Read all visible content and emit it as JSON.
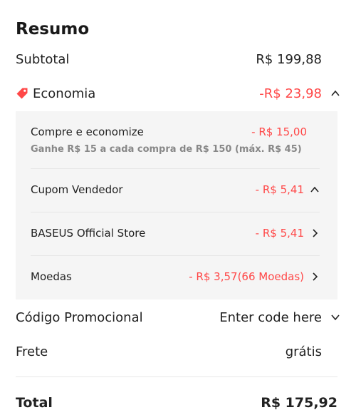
{
  "summary": {
    "title": "Resumo",
    "subtotal": {
      "label": "Subtotal",
      "value": "R$ 199,88"
    },
    "economia": {
      "label": "Economia",
      "value": "-R$ 23,98",
      "icon": "tag-icon",
      "accent": "#ff4747"
    },
    "details": {
      "compre": {
        "label": "Compre e economize",
        "value": "- R$ 15,00",
        "note": "Ganhe R$ 15 a cada compra de R$ 150 (máx. R$ 45)"
      },
      "cupom": {
        "label": "Cupom Vendedor",
        "value": "- R$ 5,41"
      },
      "store": {
        "label": "BASEUS Official Store",
        "value": "- R$ 5,41"
      },
      "moedas": {
        "label": "Moedas",
        "value": "- R$ 3,57(66 Moedas)"
      }
    },
    "promo": {
      "label": "Código Promocional",
      "placeholder": "Enter code here"
    },
    "frete": {
      "label": "Frete",
      "value": "grátis"
    },
    "total": {
      "label": "Total",
      "value": "R$ 175,92"
    }
  }
}
